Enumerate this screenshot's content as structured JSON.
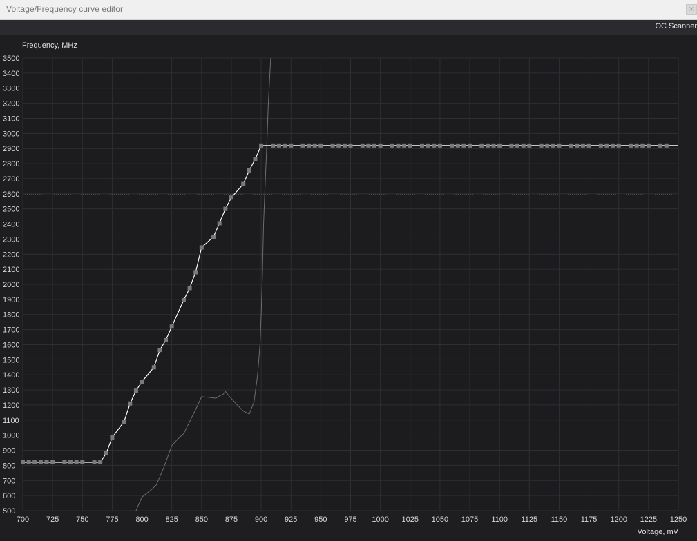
{
  "window": {
    "title": "Voltage/Frequency curve editor",
    "close_glyph": "×"
  },
  "toolbar": {
    "oc_scanner_label": "OC Scanner"
  },
  "colors": {
    "background": "#1e1e21",
    "plot_bg": "#1c1c1f",
    "grid": "#2e2e33",
    "curve": "#ffffff",
    "point": "#7a7a7a",
    "secondary_curve": "#6e6e6e",
    "reference_line": "#5a5a5a"
  },
  "chart_data": {
    "type": "line",
    "ylabel": "Frequency, MHz",
    "xlabel": "Voltage, mV",
    "xlim": [
      700,
      1250
    ],
    "ylim": [
      500,
      3500
    ],
    "x_ticks": [
      700,
      725,
      750,
      775,
      800,
      825,
      850,
      875,
      900,
      925,
      950,
      975,
      1000,
      1025,
      1050,
      1075,
      1100,
      1125,
      1150,
      1175,
      1200,
      1225,
      1250
    ],
    "y_ticks": [
      500,
      600,
      700,
      800,
      900,
      1000,
      1100,
      1200,
      1300,
      1400,
      1500,
      1600,
      1700,
      1800,
      1900,
      2000,
      2100,
      2200,
      2300,
      2400,
      2500,
      2600,
      2700,
      2800,
      2900,
      3000,
      3100,
      3200,
      3300,
      3400,
      3500
    ],
    "grid": true,
    "reference_line": {
      "y": 2595,
      "style": "dotted"
    },
    "series": [
      {
        "style": "vf-curve",
        "x": [
          700,
          705,
          710,
          715,
          720,
          725,
          735,
          740,
          745,
          750,
          760,
          765,
          770,
          775,
          785,
          790,
          795,
          800,
          810,
          815,
          820,
          825,
          835,
          840,
          845,
          850,
          860,
          865,
          870,
          875,
          885,
          890,
          895,
          900,
          910,
          915,
          920,
          925,
          935,
          940,
          945,
          950,
          960,
          965,
          970,
          975,
          985,
          990,
          995,
          1000,
          1010,
          1015,
          1020,
          1025,
          1035,
          1040,
          1045,
          1050,
          1060,
          1065,
          1070,
          1075,
          1085,
          1090,
          1095,
          1100,
          1110,
          1115,
          1120,
          1125,
          1135,
          1140,
          1145,
          1150,
          1160,
          1165,
          1170,
          1175,
          1185,
          1190,
          1195,
          1200,
          1210,
          1215,
          1220,
          1225,
          1235,
          1240
        ],
        "y": [
          820,
          820,
          820,
          820,
          820,
          820,
          820,
          820,
          820,
          820,
          820,
          820,
          880,
          985,
          1090,
          1210,
          1295,
          1355,
          1450,
          1565,
          1630,
          1720,
          1895,
          1975,
          2080,
          2245,
          2315,
          2405,
          2500,
          2575,
          2665,
          2755,
          2830,
          2920,
          2920,
          2920,
          2920,
          2920,
          2920,
          2920,
          2920,
          2920,
          2920,
          2920,
          2920,
          2920,
          2920,
          2920,
          2920,
          2920,
          2920,
          2920,
          2920,
          2920,
          2920,
          2920,
          2920,
          2920,
          2920,
          2920,
          2920,
          2920,
          2920,
          2920,
          2920,
          2920,
          2920,
          2920,
          2920,
          2920,
          2920,
          2920,
          2920,
          2920,
          2920,
          2920,
          2920,
          2920,
          2920,
          2920,
          2920,
          2920,
          2920,
          2920,
          2920,
          2920,
          2920,
          2920
        ],
        "line_x_end": 1250
      },
      {
        "style": "secondary",
        "x": [
          795,
          800,
          808,
          812,
          818,
          825,
          830,
          835,
          840,
          845,
          850,
          857,
          862,
          865,
          868,
          870,
          873,
          880,
          885,
          890,
          894,
          897,
          899,
          900,
          901,
          902,
          903,
          905,
          906,
          908
        ],
        "y": [
          500,
          590,
          640,
          670,
          780,
          930,
          975,
          1010,
          1090,
          1170,
          1255,
          1250,
          1245,
          1260,
          1270,
          1290,
          1260,
          1200,
          1160,
          1140,
          1220,
          1400,
          1600,
          1800,
          2050,
          2400,
          2600,
          2980,
          3200,
          3500
        ]
      }
    ]
  }
}
